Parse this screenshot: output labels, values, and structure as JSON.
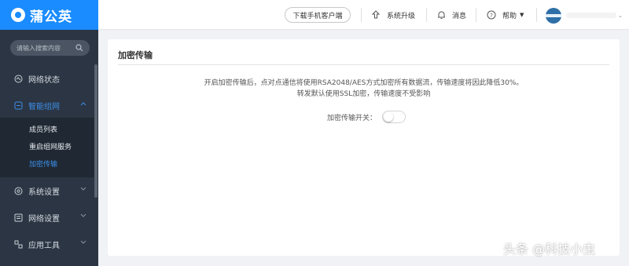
{
  "brand": {
    "name": "蒲公英",
    "color": "#1a8cff"
  },
  "header": {
    "download_client": "下载手机客户端",
    "system_upgrade": "系统升级",
    "messages": "消息",
    "help": "帮助"
  },
  "sidebar": {
    "search_placeholder": "请输入搜索内容",
    "items": [
      {
        "label": "网络状态"
      },
      {
        "label": "智能组网",
        "active": true
      },
      {
        "label": "系统设置"
      },
      {
        "label": "网络设置"
      },
      {
        "label": "应用工具"
      }
    ],
    "submenu": [
      {
        "label": "成员列表"
      },
      {
        "label": "重启组网服务"
      },
      {
        "label": "加密传输",
        "active": true
      }
    ]
  },
  "panel": {
    "title": "加密传输",
    "desc_line1": "开启加密传输后，点对点通信将使用RSA2048/AES方式加密所有数据流，传输速度将因此降低30%。",
    "desc_line2": "转发默认使用SSL加密，传输速度不受影响",
    "toggle_label": "加密传输开关：",
    "toggle_on": false
  },
  "watermark": "头条 @科技小虫",
  "colors": {
    "accent": "#3d8fe8",
    "sidebar_bg": "#2b3543"
  }
}
